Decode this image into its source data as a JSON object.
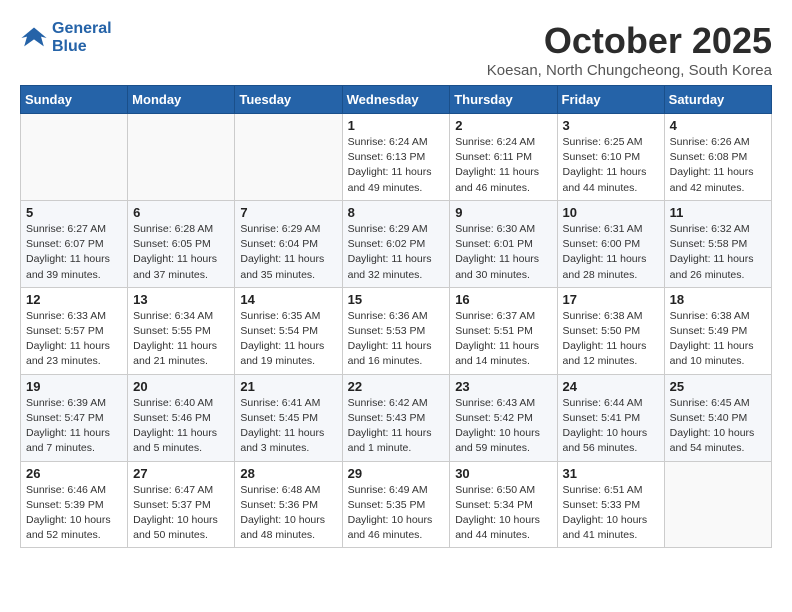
{
  "logo": {
    "line1": "General",
    "line2": "Blue"
  },
  "title": "October 2025",
  "location": "Koesan, North Chungcheong, South Korea",
  "weekdays": [
    "Sunday",
    "Monday",
    "Tuesday",
    "Wednesday",
    "Thursday",
    "Friday",
    "Saturday"
  ],
  "weeks": [
    [
      {
        "day": "",
        "info": ""
      },
      {
        "day": "",
        "info": ""
      },
      {
        "day": "",
        "info": ""
      },
      {
        "day": "1",
        "info": "Sunrise: 6:24 AM\nSunset: 6:13 PM\nDaylight: 11 hours\nand 49 minutes."
      },
      {
        "day": "2",
        "info": "Sunrise: 6:24 AM\nSunset: 6:11 PM\nDaylight: 11 hours\nand 46 minutes."
      },
      {
        "day": "3",
        "info": "Sunrise: 6:25 AM\nSunset: 6:10 PM\nDaylight: 11 hours\nand 44 minutes."
      },
      {
        "day": "4",
        "info": "Sunrise: 6:26 AM\nSunset: 6:08 PM\nDaylight: 11 hours\nand 42 minutes."
      }
    ],
    [
      {
        "day": "5",
        "info": "Sunrise: 6:27 AM\nSunset: 6:07 PM\nDaylight: 11 hours\nand 39 minutes."
      },
      {
        "day": "6",
        "info": "Sunrise: 6:28 AM\nSunset: 6:05 PM\nDaylight: 11 hours\nand 37 minutes."
      },
      {
        "day": "7",
        "info": "Sunrise: 6:29 AM\nSunset: 6:04 PM\nDaylight: 11 hours\nand 35 minutes."
      },
      {
        "day": "8",
        "info": "Sunrise: 6:29 AM\nSunset: 6:02 PM\nDaylight: 11 hours\nand 32 minutes."
      },
      {
        "day": "9",
        "info": "Sunrise: 6:30 AM\nSunset: 6:01 PM\nDaylight: 11 hours\nand 30 minutes."
      },
      {
        "day": "10",
        "info": "Sunrise: 6:31 AM\nSunset: 6:00 PM\nDaylight: 11 hours\nand 28 minutes."
      },
      {
        "day": "11",
        "info": "Sunrise: 6:32 AM\nSunset: 5:58 PM\nDaylight: 11 hours\nand 26 minutes."
      }
    ],
    [
      {
        "day": "12",
        "info": "Sunrise: 6:33 AM\nSunset: 5:57 PM\nDaylight: 11 hours\nand 23 minutes."
      },
      {
        "day": "13",
        "info": "Sunrise: 6:34 AM\nSunset: 5:55 PM\nDaylight: 11 hours\nand 21 minutes."
      },
      {
        "day": "14",
        "info": "Sunrise: 6:35 AM\nSunset: 5:54 PM\nDaylight: 11 hours\nand 19 minutes."
      },
      {
        "day": "15",
        "info": "Sunrise: 6:36 AM\nSunset: 5:53 PM\nDaylight: 11 hours\nand 16 minutes."
      },
      {
        "day": "16",
        "info": "Sunrise: 6:37 AM\nSunset: 5:51 PM\nDaylight: 11 hours\nand 14 minutes."
      },
      {
        "day": "17",
        "info": "Sunrise: 6:38 AM\nSunset: 5:50 PM\nDaylight: 11 hours\nand 12 minutes."
      },
      {
        "day": "18",
        "info": "Sunrise: 6:38 AM\nSunset: 5:49 PM\nDaylight: 11 hours\nand 10 minutes."
      }
    ],
    [
      {
        "day": "19",
        "info": "Sunrise: 6:39 AM\nSunset: 5:47 PM\nDaylight: 11 hours\nand 7 minutes."
      },
      {
        "day": "20",
        "info": "Sunrise: 6:40 AM\nSunset: 5:46 PM\nDaylight: 11 hours\nand 5 minutes."
      },
      {
        "day": "21",
        "info": "Sunrise: 6:41 AM\nSunset: 5:45 PM\nDaylight: 11 hours\nand 3 minutes."
      },
      {
        "day": "22",
        "info": "Sunrise: 6:42 AM\nSunset: 5:43 PM\nDaylight: 11 hours\nand 1 minute."
      },
      {
        "day": "23",
        "info": "Sunrise: 6:43 AM\nSunset: 5:42 PM\nDaylight: 10 hours\nand 59 minutes."
      },
      {
        "day": "24",
        "info": "Sunrise: 6:44 AM\nSunset: 5:41 PM\nDaylight: 10 hours\nand 56 minutes."
      },
      {
        "day": "25",
        "info": "Sunrise: 6:45 AM\nSunset: 5:40 PM\nDaylight: 10 hours\nand 54 minutes."
      }
    ],
    [
      {
        "day": "26",
        "info": "Sunrise: 6:46 AM\nSunset: 5:39 PM\nDaylight: 10 hours\nand 52 minutes."
      },
      {
        "day": "27",
        "info": "Sunrise: 6:47 AM\nSunset: 5:37 PM\nDaylight: 10 hours\nand 50 minutes."
      },
      {
        "day": "28",
        "info": "Sunrise: 6:48 AM\nSunset: 5:36 PM\nDaylight: 10 hours\nand 48 minutes."
      },
      {
        "day": "29",
        "info": "Sunrise: 6:49 AM\nSunset: 5:35 PM\nDaylight: 10 hours\nand 46 minutes."
      },
      {
        "day": "30",
        "info": "Sunrise: 6:50 AM\nSunset: 5:34 PM\nDaylight: 10 hours\nand 44 minutes."
      },
      {
        "day": "31",
        "info": "Sunrise: 6:51 AM\nSunset: 5:33 PM\nDaylight: 10 hours\nand 41 minutes."
      },
      {
        "day": "",
        "info": ""
      }
    ]
  ]
}
